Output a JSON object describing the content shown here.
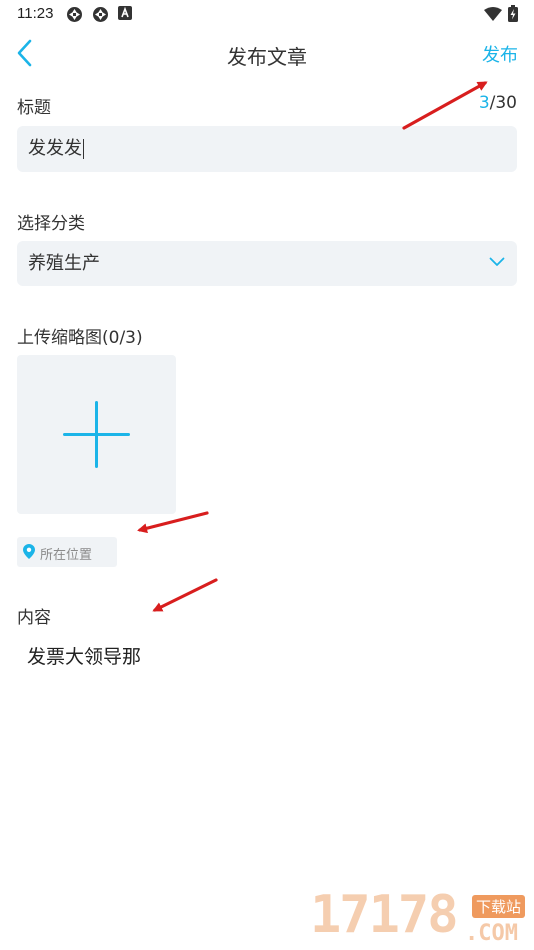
{
  "status_bar": {
    "time": "11:23",
    "icons": [
      "aperture-icon",
      "aperture-icon",
      "a-badge-icon",
      "wifi-icon",
      "battery-charging-icon"
    ]
  },
  "navbar": {
    "title": "发布文章",
    "publish_label": "发布",
    "back_icon": "chevron-left-icon"
  },
  "form": {
    "title_label": "标题",
    "title_count": "3",
    "title_max": "/30",
    "title_value": "发发发",
    "category_label": "选择分类",
    "category_value": "养殖生产",
    "thumbnail_label": "上传缩略图(0/3)",
    "location_placeholder": "所在位置",
    "content_label": "内容",
    "content_value": "发票大领导那"
  },
  "colors": {
    "accent": "#1bb4e8",
    "field_bg": "#f0f3f6",
    "annotation": "#d81e1e"
  },
  "watermark": {
    "number": "17178",
    "tag": "下载站",
    "domain": ".COM"
  }
}
